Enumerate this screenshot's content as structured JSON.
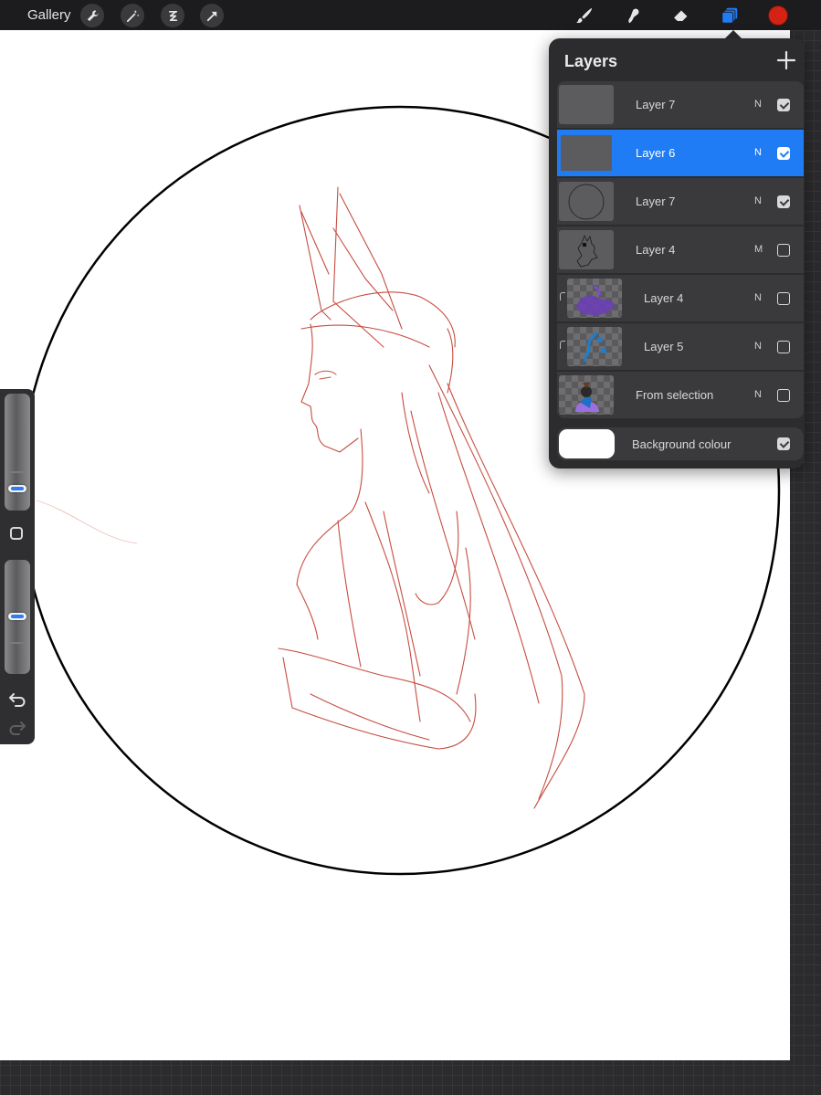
{
  "topbar": {
    "gallery_label": "Gallery",
    "left_tools": [
      "wrench-icon",
      "magic-wand-icon",
      "selection-icon",
      "transform-arrow-icon"
    ],
    "right_tools": [
      "brush-icon",
      "smudge-icon",
      "eraser-icon",
      "layers-icon"
    ],
    "active_color": "#d42214",
    "active_tool_accent": "#1f7cf5"
  },
  "sidebar": {
    "brush_size": 0.32,
    "opacity": 0.5,
    "controls": [
      "size-slider",
      "modify-square",
      "opacity-slider",
      "undo-icon",
      "redo-icon"
    ]
  },
  "layers_panel": {
    "title": "Layers",
    "add_icon": "plus-icon",
    "layers": [
      {
        "name": "Layer 7",
        "blend": "N",
        "visible": true,
        "selected": false,
        "clipped": false
      },
      {
        "name": "Layer 6",
        "blend": "N",
        "visible": true,
        "selected": true,
        "clipped": false
      },
      {
        "name": "Layer 7",
        "blend": "N",
        "visible": true,
        "selected": false,
        "clipped": false
      },
      {
        "name": "Layer 4",
        "blend": "M",
        "visible": false,
        "selected": false,
        "clipped": false
      },
      {
        "name": "Layer 4",
        "blend": "N",
        "visible": false,
        "selected": false,
        "clipped": true
      },
      {
        "name": "Layer 5",
        "blend": "N",
        "visible": false,
        "selected": false,
        "clipped": true
      },
      {
        "name": "From selection",
        "blend": "N",
        "visible": false,
        "selected": false,
        "clipped": false
      }
    ],
    "background": {
      "label": "Background colour",
      "visible": true,
      "color": "#ffffff"
    }
  },
  "canvas": {
    "sketch_color": "#c0392b",
    "frame_color": "#000000"
  }
}
